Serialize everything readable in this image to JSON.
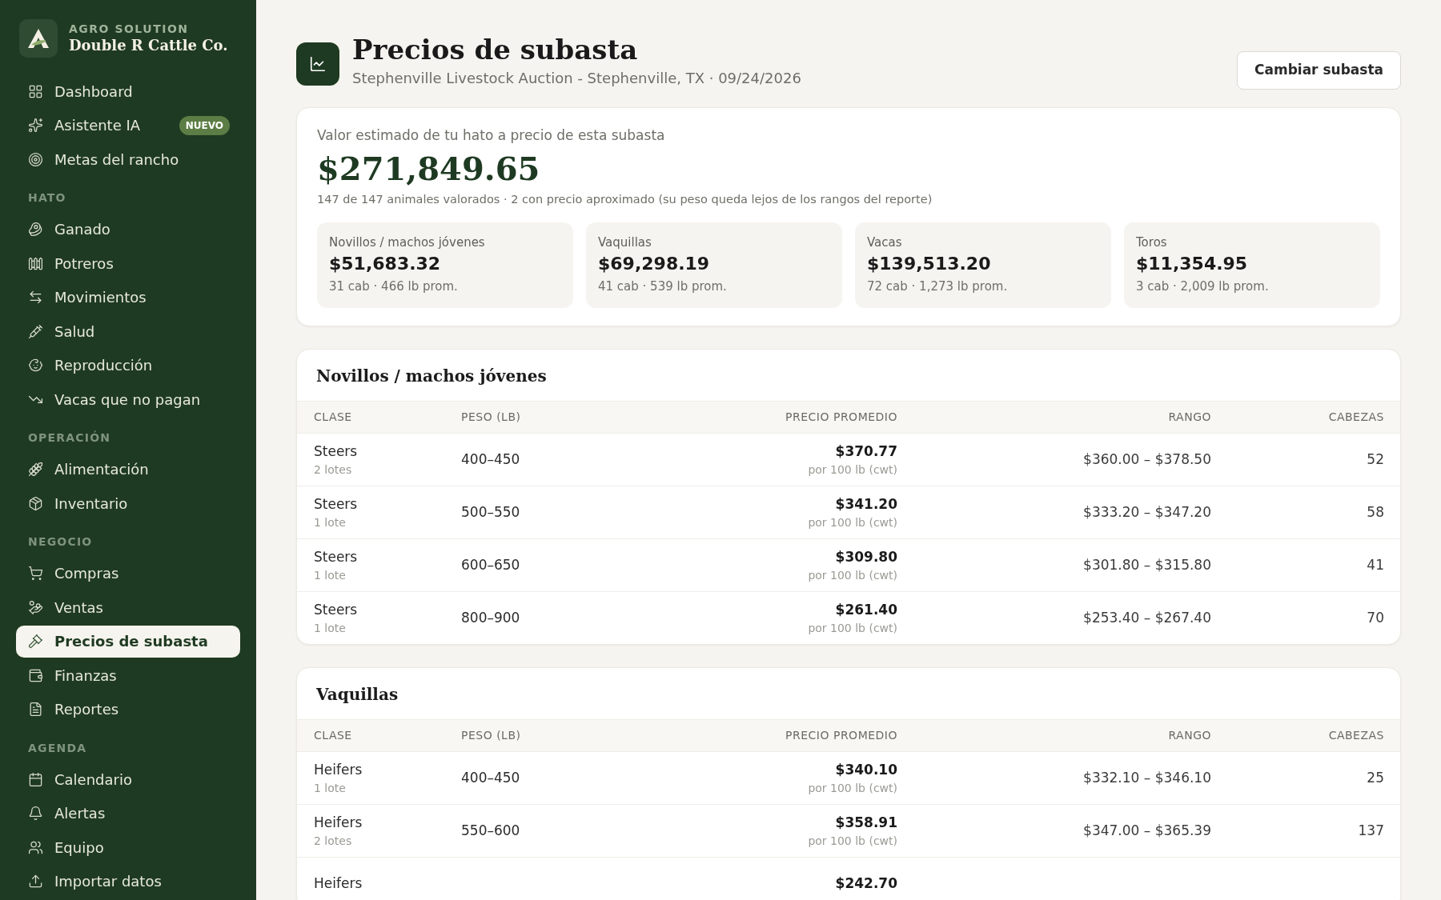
{
  "brand": {
    "eyebrow": "AGRO SOLUTION",
    "name": "Double R Cattle Co."
  },
  "sidebar": {
    "sections": [
      {
        "items": [
          {
            "label": "Dashboard",
            "selected": false
          },
          {
            "label": "Asistente IA",
            "badge": "NUEVO",
            "selected": false
          },
          {
            "label": "Metas del rancho",
            "selected": false
          }
        ]
      },
      {
        "title": "HATO",
        "items": [
          {
            "label": "Ganado",
            "selected": false
          },
          {
            "label": "Potreros",
            "selected": false
          },
          {
            "label": "Movimientos",
            "selected": false
          },
          {
            "label": "Salud",
            "selected": false
          },
          {
            "label": "Reproducción",
            "selected": false
          },
          {
            "label": "Vacas que no pagan",
            "selected": false
          }
        ]
      },
      {
        "title": "OPERACIÓN",
        "items": [
          {
            "label": "Alimentación",
            "selected": false
          },
          {
            "label": "Inventario",
            "selected": false
          }
        ]
      },
      {
        "title": "NEGOCIO",
        "items": [
          {
            "label": "Compras",
            "selected": false
          },
          {
            "label": "Ventas",
            "selected": false
          },
          {
            "label": "Precios de subasta",
            "selected": true
          },
          {
            "label": "Finanzas",
            "selected": false
          },
          {
            "label": "Reportes",
            "selected": false
          }
        ]
      },
      {
        "title": "AGENDA",
        "items": [
          {
            "label": "Calendario",
            "selected": false
          },
          {
            "label": "Alertas",
            "selected": false
          },
          {
            "label": "Equipo",
            "selected": false
          },
          {
            "label": "Importar datos",
            "selected": false
          }
        ]
      }
    ]
  },
  "header": {
    "title": "Precios de subasta",
    "subtitle": "Stephenville Livestock Auction - Stephenville, TX · 09/24/2026",
    "button": "Cambiar subasta"
  },
  "summary": {
    "label": "Valor estimado de tu hato a precio de esta subasta",
    "value": "$271,849.65",
    "note": "147 de 147 animales valorados · 2 con precio aproximado (su peso queda lejos de los rangos del reporte)",
    "categories": [
      {
        "name": "Novillos / machos jóvenes",
        "value": "$51,683.32",
        "detail": "31 cab · 466 lb prom."
      },
      {
        "name": "Vaquillas",
        "value": "$69,298.19",
        "detail": "41 cab · 539 lb prom."
      },
      {
        "name": "Vacas",
        "value": "$139,513.20",
        "detail": "72 cab · 1,273 lb prom."
      },
      {
        "name": "Toros",
        "value": "$11,354.95",
        "detail": "3 cab · 2,009 lb prom."
      }
    ]
  },
  "tables": [
    {
      "title": "Novillos / machos jóvenes",
      "columns": [
        "CLASE",
        "PESO (LB)",
        "PRECIO PROMEDIO",
        "RANGO",
        "CABEZAS"
      ],
      "rows": [
        {
          "class": "Steers",
          "lots": "2 lotes",
          "weight": "400–450",
          "price": "$370.77",
          "unit": "por 100 lb (cwt)",
          "range": "$360.00 – $378.50",
          "head": "52"
        },
        {
          "class": "Steers",
          "lots": "1 lote",
          "weight": "500–550",
          "price": "$341.20",
          "unit": "por 100 lb (cwt)",
          "range": "$333.20 – $347.20",
          "head": "58"
        },
        {
          "class": "Steers",
          "lots": "1 lote",
          "weight": "600–650",
          "price": "$309.80",
          "unit": "por 100 lb (cwt)",
          "range": "$301.80 – $315.80",
          "head": "41"
        },
        {
          "class": "Steers",
          "lots": "1 lote",
          "weight": "800–900",
          "price": "$261.40",
          "unit": "por 100 lb (cwt)",
          "range": "$253.40 – $267.40",
          "head": "70"
        }
      ]
    },
    {
      "title": "Vaquillas",
      "columns": [
        "CLASE",
        "PESO (LB)",
        "PRECIO PROMEDIO",
        "RANGO",
        "CABEZAS"
      ],
      "rows": [
        {
          "class": "Heifers",
          "lots": "1 lote",
          "weight": "400–450",
          "price": "$340.10",
          "unit": "por 100 lb (cwt)",
          "range": "$332.10 – $346.10",
          "head": "25"
        },
        {
          "class": "Heifers",
          "lots": "2 lotes",
          "weight": "550–600",
          "price": "$358.91",
          "unit": "por 100 lb (cwt)",
          "range": "$347.00 – $365.39",
          "head": "137"
        },
        {
          "class": "Heifers",
          "price": "$242.70"
        }
      ]
    }
  ]
}
